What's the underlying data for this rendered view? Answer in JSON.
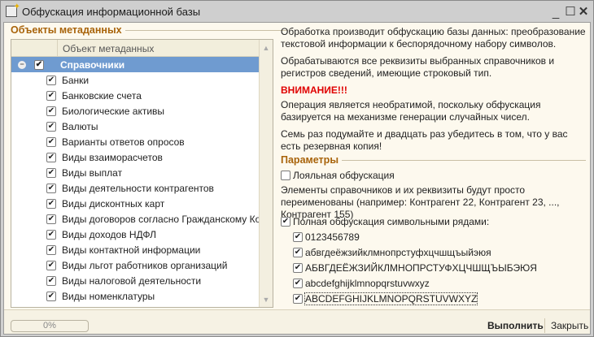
{
  "window": {
    "title": "Обфускация информационной базы"
  },
  "left": {
    "legend": "Объекты метаданных",
    "column_header": "Объект метаданных",
    "group": {
      "label": "Справочники",
      "checked": true,
      "expanded": true
    },
    "items": [
      {
        "label": "Банки",
        "checked": true
      },
      {
        "label": "Банковские счета",
        "checked": true
      },
      {
        "label": "Биологические активы",
        "checked": true
      },
      {
        "label": "Валюты",
        "checked": true
      },
      {
        "label": "Варианты ответов опросов",
        "checked": true
      },
      {
        "label": "Виды взаиморасчетов",
        "checked": true
      },
      {
        "label": "Виды выплат",
        "checked": true
      },
      {
        "label": "Виды деятельности контрагентов",
        "checked": true
      },
      {
        "label": "Виды дисконтных карт",
        "checked": true
      },
      {
        "label": "Виды договоров согласно Гражданскому Ко...",
        "checked": true
      },
      {
        "label": "Виды доходов НДФЛ",
        "checked": true
      },
      {
        "label": "Виды контактной информации",
        "checked": true
      },
      {
        "label": "Виды льгот работников организаций",
        "checked": true
      },
      {
        "label": "Виды налоговой деятельности",
        "checked": true
      },
      {
        "label": "Виды номенклатуры",
        "checked": true
      }
    ]
  },
  "right": {
    "p1": "Обработка производит обфускацию базы данных: преобразование текстовой информации к беспорядочному набору символов.",
    "p2": "Обрабатываются все реквизиты выбранных справочников и регистров сведений, имеющие строковый тип.",
    "warning": "ВНИМАНИЕ!!!",
    "p3": "Операция является необратимой, поскольку обфускация базируется на механизме генерации случайных чисел.",
    "p4": "Семь раз подумайте и двадцать раз убедитесь в том, что у вас есть резервная копия!",
    "params_legend": "Параметры",
    "loyal": {
      "label": "Лояльная обфускация",
      "checked": false
    },
    "loyal_desc": "Элементы справочников и их реквизиты будут просто переименованы (например: Контрагент 22, Контрагент 23, ..., Контрагент 155)",
    "full": {
      "label": "Полная обфускация символьными рядами:",
      "checked": true
    },
    "rows": [
      {
        "label": "0123456789",
        "checked": true
      },
      {
        "label": "абвгдеёжзийклмнопрстуфхцчшщъыйэюя",
        "checked": true
      },
      {
        "label": "АБВГДЕЁЖЗИЙКЛМНОПРСТУФХЦЧШЩЪЫБЭЮЯ",
        "checked": true
      },
      {
        "label": "abcdefghijklmnopqrstuvwxyz",
        "checked": true
      },
      {
        "label": "ABCDEFGHIJKLMNOPQRSTUVWXYZ",
        "checked": true
      }
    ]
  },
  "footer": {
    "progress": "0%",
    "progress_value": 0,
    "run": "Выполнить",
    "close": "Закрыть"
  },
  "colors": {
    "accent": "#a8630a",
    "selected": "#6f9bd0",
    "warning": "#e00000"
  }
}
